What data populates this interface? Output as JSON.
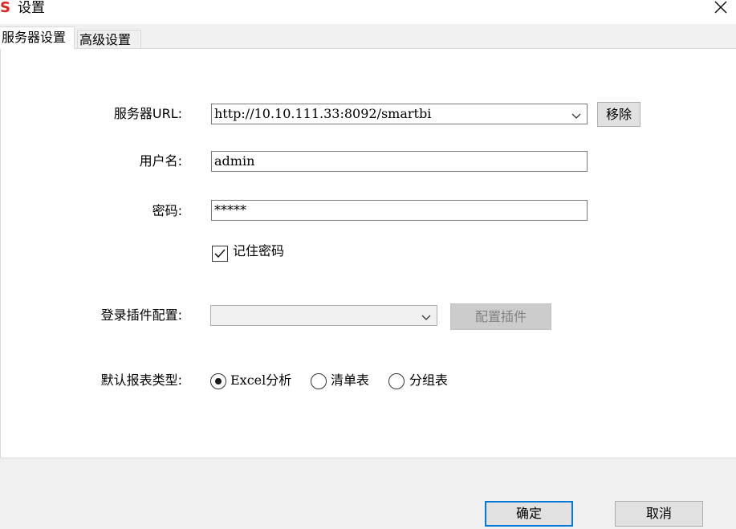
{
  "window": {
    "logo": "S",
    "title": "设置",
    "close_icon": "close-icon"
  },
  "tabs": [
    {
      "label": "服务器设置",
      "active": true
    },
    {
      "label": "高级设置",
      "active": false
    }
  ],
  "server": {
    "label": "服务器URL:",
    "value": "http://10.10.111.33:8092/smartbi",
    "remove_label": "移除"
  },
  "username": {
    "label": "用户名:",
    "value": "admin"
  },
  "password": {
    "label": "密码:",
    "value": "*****"
  },
  "remember": {
    "label": "记住密码",
    "checked": true
  },
  "plugin": {
    "label": "登录插件配置:",
    "value": "",
    "button_label": "配置插件",
    "button_disabled": true
  },
  "report_type": {
    "label": "默认报表类型:",
    "options": [
      {
        "label": "Excel分析",
        "selected": true
      },
      {
        "label": "清单表",
        "selected": false
      },
      {
        "label": "分组表",
        "selected": false
      }
    ]
  },
  "footer": {
    "ok_label": "确定",
    "cancel_label": "取消"
  },
  "colors": {
    "logo": "#e02222",
    "focus_border": "#0078d7"
  }
}
